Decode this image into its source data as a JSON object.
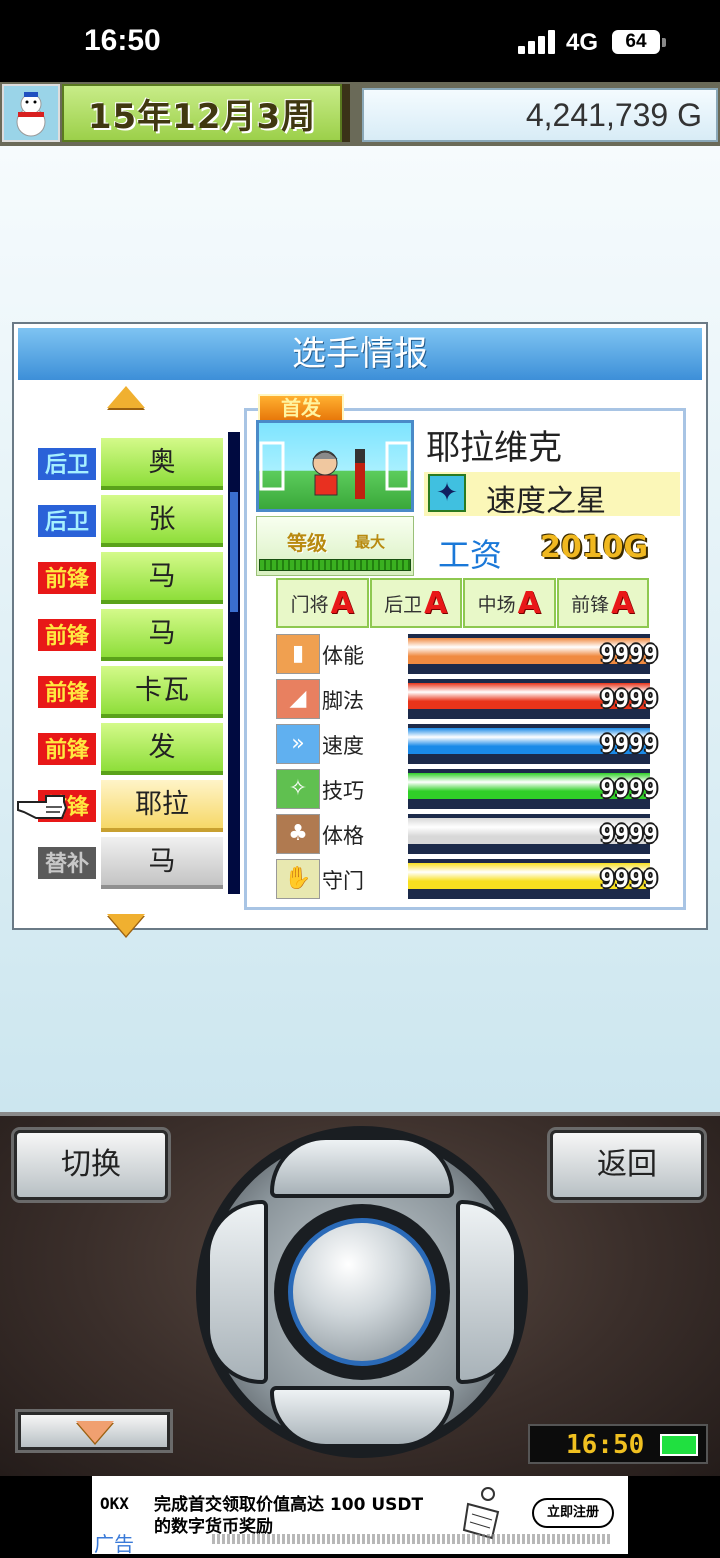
{
  "status_bar": {
    "time": "16:50",
    "network": "4G",
    "battery": "64"
  },
  "top_bar": {
    "date": "15年12月3周",
    "money": "4,241,739 G"
  },
  "panel": {
    "title": "选手情报",
    "roster": [
      {
        "position": "后卫",
        "name": "奥",
        "kind": "def"
      },
      {
        "position": "后卫",
        "name": "张",
        "kind": "def"
      },
      {
        "position": "前锋",
        "name": "马",
        "kind": "fwd"
      },
      {
        "position": "前锋",
        "name": "马",
        "kind": "fwd"
      },
      {
        "position": "前锋",
        "name": "卡瓦",
        "kind": "fwd"
      },
      {
        "position": "前锋",
        "name": "发",
        "kind": "fwd"
      },
      {
        "position": "前锋",
        "name": "耶拉",
        "kind": "fwd"
      },
      {
        "position": "替补",
        "name": "马",
        "kind": "sub"
      }
    ]
  },
  "player": {
    "tag": "首发",
    "name": "耶拉维克",
    "skill_icon": "runner-icon",
    "skill": "速度之星",
    "level_label": "等级",
    "level_value": "最大",
    "salary_label": "工资",
    "salary_value": "2010G",
    "aptitudes": [
      {
        "position": "门将",
        "grade": "A"
      },
      {
        "position": "后卫",
        "grade": "A"
      },
      {
        "position": "中场",
        "grade": "A"
      },
      {
        "position": "前锋",
        "grade": "A"
      }
    ],
    "stats": [
      {
        "name": "体能",
        "value": "9999",
        "color": "#f08a40",
        "icon": "stamina-icon",
        "level": 1.0
      },
      {
        "name": "脚法",
        "value": "9999",
        "color": "#e8341a",
        "icon": "kick-icon",
        "level": 1.0
      },
      {
        "name": "速度",
        "value": "9999",
        "color": "#1a8ae8",
        "icon": "speed-icon",
        "level": 1.0
      },
      {
        "name": "技巧",
        "value": "9999",
        "color": "#30d028",
        "icon": "technique-icon",
        "level": 1.0
      },
      {
        "name": "体格",
        "value": "9999",
        "color": "#d8d8d8",
        "icon": "physique-icon",
        "level": 1.0
      },
      {
        "name": "守门",
        "value": "9999",
        "color": "#f8e020",
        "icon": "goalkeeping-icon",
        "level": 1.0
      }
    ]
  },
  "controller": {
    "switch_label": "切换",
    "back_label": "返回",
    "clock": "16:50"
  },
  "ad": {
    "logo": "OKX",
    "line1": "完成首交领取价值高达 100 USDT",
    "line2": "的数字货币奖励",
    "cta": "立即注册",
    "tag": "广告"
  }
}
